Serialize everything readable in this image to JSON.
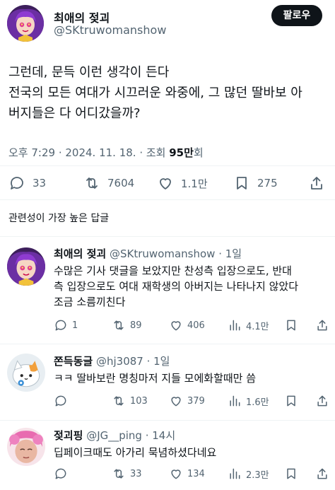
{
  "tweet": {
    "author_name": "최애의 젖괴",
    "author_handle": "@SKtruwomanshow",
    "follow_label": "팔로우",
    "text_lines": [
      "그런데, 문득 이런 생각이 든다",
      "전국의 모든 여대가 시끄러운 와중에, 그 많던 딸바보 아",
      "버지들은 다 어디갔을까?"
    ],
    "time": "오후 7:29 · 2024. 11. 18. · 조회 ",
    "views": "95만",
    "views_suffix": "회",
    "stats": {
      "replies": "33",
      "retweets": "7604",
      "likes": "1.1만",
      "bookmarks": "275"
    }
  },
  "sort_label": "관련성이 가장 높은 답글",
  "replies": [
    {
      "name": "최애의 젖괴",
      "handle": "@SKtruwomanshow · 1일",
      "text_lines": [
        "수많은 기사 댓글을 보았지만 찬성측 입장으로도, 반대",
        "측 입장으로도 여대 재학생의 아버지는 나타나지 않았다",
        "조금 소름끼친다"
      ],
      "replies": "1",
      "retweets": "89",
      "likes": "406",
      "views": "4.1만"
    },
    {
      "name": "쫀득동글",
      "handle": "@hj3087 · 1일",
      "text_lines": [
        "ㅋㅋ 딸바보란 명칭마저 지들 모에화할때만 씀"
      ],
      "replies": "",
      "retweets": "103",
      "likes": "379",
      "views": "1.6만"
    },
    {
      "name": "젖괴핑",
      "handle": "@JG__ping · 14시",
      "text_lines": [
        "딥페이크때도 아가리 묵념하셨다네요"
      ],
      "replies": "",
      "retweets": "33",
      "likes": "134",
      "views": "2.3만"
    }
  ],
  "colors": {
    "text": "#0f1419",
    "secondary": "#536471",
    "divider": "#eff3f4",
    "follow_bg": "#0f1419"
  }
}
